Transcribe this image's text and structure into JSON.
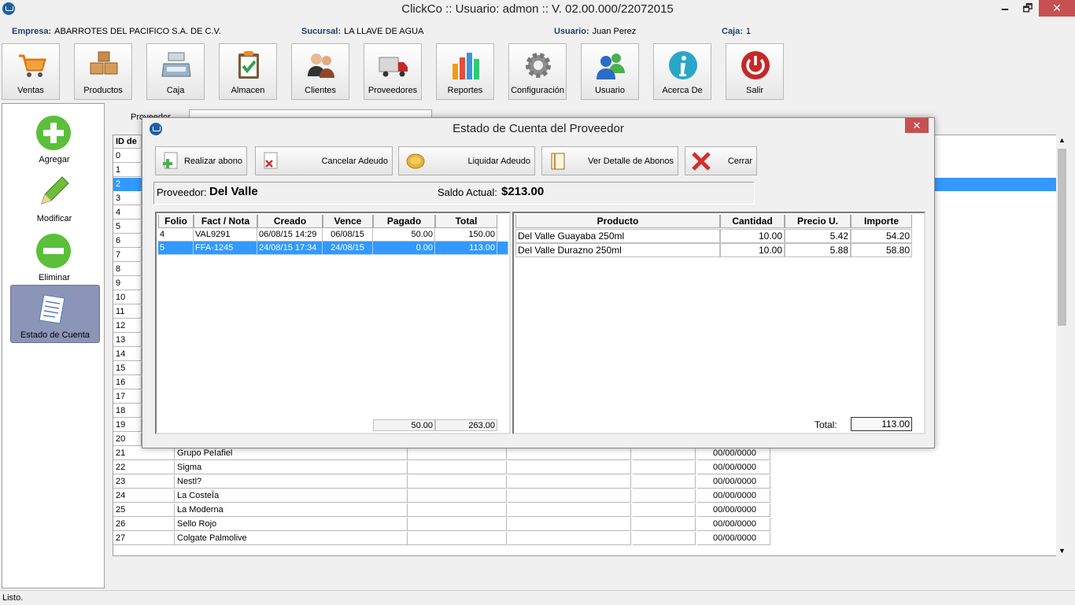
{
  "window": {
    "title": "ClickCo :: Usuario: admon :: V. 02.00.000/22072015",
    "min": "🗕",
    "max": "🗗",
    "close": "✕"
  },
  "info": {
    "empresa_label": "Empresa:",
    "empresa": "ABARROTES DEL PACIFICO S.A. DE C.V.",
    "sucursal_label": "Sucursal:",
    "sucursal": "LA LLAVE DE AGUA",
    "usuario_label": "Usuario:",
    "usuario": "Juan Perez",
    "caja_label": "Caja:",
    "caja": "1"
  },
  "toolbar": [
    "Ventas",
    "Productos",
    "Caja",
    "Almacen",
    "Clientes",
    "Proveedores",
    "Reportes",
    "Configuración",
    "Usuario",
    "Acerca De",
    "Salir"
  ],
  "leftpanel": {
    "agregar": "Agregar",
    "modificar": "Modificar",
    "eliminar": "Eliminar",
    "estado": "Estado de Cuenta"
  },
  "main": {
    "search_label": "Proveedor",
    "grid_header": "ID de",
    "rows_ids": [
      "0",
      "1",
      "2",
      "3",
      "4",
      "5",
      "6",
      "7",
      "8",
      "9",
      "10",
      "11",
      "12",
      "13",
      "14",
      "15",
      "16",
      "17",
      "18",
      "19",
      "20"
    ],
    "rows_full": [
      {
        "id": "21",
        "name": "Grupo PeIafiel",
        "date": "00/00/0000"
      },
      {
        "id": "22",
        "name": "Sigma",
        "date": "00/00/0000"
      },
      {
        "id": "23",
        "name": "Nestl?",
        "date": "00/00/0000"
      },
      {
        "id": "24",
        "name": "La CosteÏa",
        "date": "00/00/0000"
      },
      {
        "id": "25",
        "name": "La Moderna",
        "date": "00/00/0000"
      },
      {
        "id": "26",
        "name": "Sello Rojo",
        "date": "00/00/0000"
      },
      {
        "id": "27",
        "name": "Colgate Palmolive",
        "date": "00/00/0000"
      }
    ]
  },
  "status": "Listo.",
  "dialog": {
    "title": "Estado de Cuenta del Proveedor",
    "close": "✕",
    "buttons": {
      "abono": "Realizar abono",
      "cancelar": "Cancelar Adeudo",
      "liquidar": "Liquidar Adeudo",
      "detalle": "Ver Detalle de Abonos",
      "cerrar": "Cerrar"
    },
    "proveedor_label": "Proveedor:",
    "proveedor": "Del Valle",
    "saldo_label": "Saldo Actual:",
    "saldo": "$213.00",
    "notas": {
      "headers": [
        "Folio",
        "Fact / Nota",
        "Creado",
        "Vence",
        "Pagado",
        "Total"
      ],
      "rows": [
        [
          "4",
          "VAL9291",
          "06/08/15 14:29",
          "06/08/15",
          "50.00",
          "150.00"
        ],
        [
          "5",
          "FFA-1245",
          "24/08/15 17:34",
          "24/08/15",
          "0.00",
          "113.00"
        ]
      ],
      "sum_pagado": "50.00",
      "sum_total": "263.00"
    },
    "productos": {
      "headers": [
        "Producto",
        "Cantidad",
        "Precio U.",
        "Importe"
      ],
      "rows": [
        [
          "Del Valle Guayaba 250ml",
          "10.00",
          "5.42",
          "54.20"
        ],
        [
          "Del Valle Durazno 250ml",
          "10.00",
          "5.88",
          "58.80"
        ]
      ],
      "total_label": "Total:",
      "total": "113.00"
    }
  }
}
